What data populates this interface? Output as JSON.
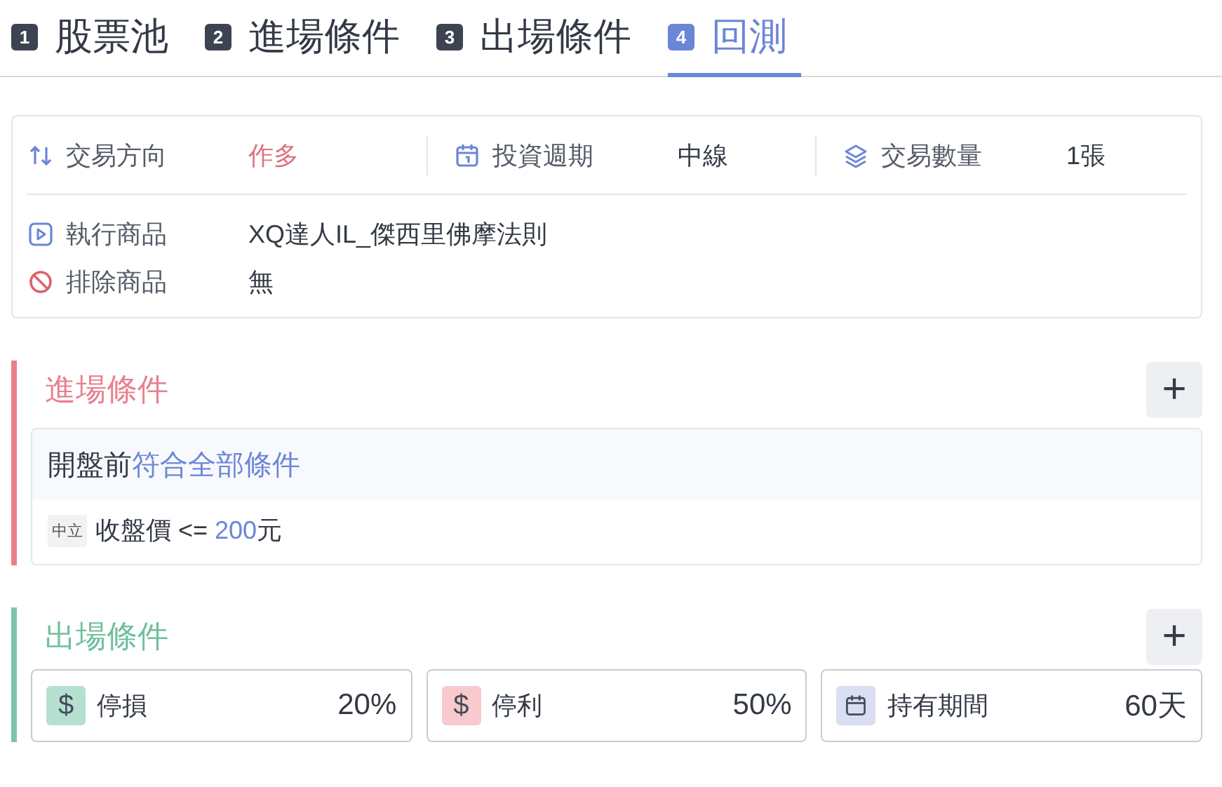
{
  "tabs": [
    {
      "number": "1",
      "label": "股票池",
      "selected": false
    },
    {
      "number": "2",
      "label": "進場條件",
      "selected": false
    },
    {
      "number": "3",
      "label": "出場條件",
      "selected": false
    },
    {
      "number": "4",
      "label": "回測",
      "selected": true
    }
  ],
  "summary": {
    "top": [
      {
        "kind": "direction",
        "label": "交易方向",
        "value": "作多",
        "highlight": true
      },
      {
        "kind": "period",
        "label": "投資週期",
        "value": "中線",
        "highlight": false
      },
      {
        "kind": "quantity",
        "label": "交易數量",
        "value": "1張",
        "highlight": false
      }
    ],
    "rows": [
      {
        "kind": "run",
        "label": "執行商品",
        "value": "XQ達人IL_傑西里佛摩法則"
      },
      {
        "kind": "exclude",
        "label": "排除商品",
        "value": "無"
      }
    ]
  },
  "entry": {
    "title": "進場條件",
    "add": "+",
    "group": {
      "prefix": "開盤前",
      "match": "符合全部條件"
    },
    "conditions": [
      {
        "tag": "中立",
        "before": "收盤價 <= ",
        "value": "200",
        "after": "元"
      }
    ]
  },
  "exit": {
    "title": "出場條件",
    "add": "+",
    "items": [
      {
        "kind": "money",
        "symbol": "$",
        "color": "#b5e0d0",
        "label": "停損",
        "value": "20%"
      },
      {
        "kind": "money",
        "symbol": "$",
        "color": "#f8c9cd",
        "label": "停利",
        "value": "50%"
      },
      {
        "kind": "calendar",
        "color": "#d9def0",
        "label": "持有期間",
        "value": "60天"
      }
    ]
  }
}
